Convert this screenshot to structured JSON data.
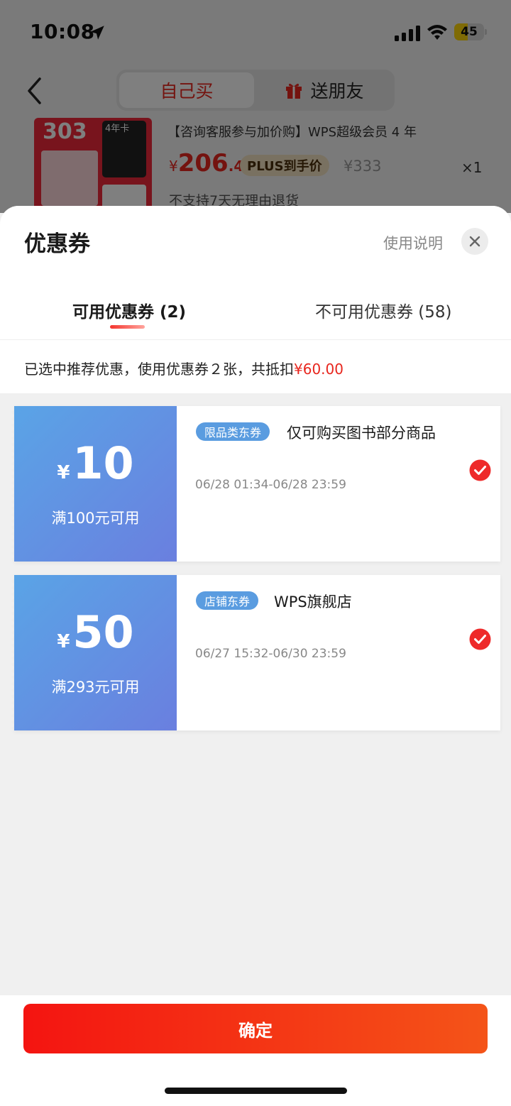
{
  "status_bar": {
    "time": "10:08",
    "battery": "45"
  },
  "background_page": {
    "tabs": {
      "self_buy": "自己买",
      "gift": "送朋友"
    },
    "product": {
      "title": "【咨询客服参与加价购】WPS超级会员 4 年",
      "price_currency": "¥",
      "price_int": "206",
      "price_dec": ".4",
      "plus_tag": "PLUS到手价",
      "original_price": "¥333",
      "quantity": "×1",
      "return_policy": "不支持7天无理由退货",
      "thumb_text": "303",
      "thumb_card_text": "4年卡"
    }
  },
  "sheet": {
    "title": "优惠券",
    "help_link": "使用说明",
    "tabs": {
      "available": "可用优惠券 (2)",
      "unavailable": "不可用优惠券 (58)"
    },
    "summary_text": "已选中推荐优惠，使用优惠券２张，共抵扣",
    "summary_amount": "¥60.00",
    "coupons": [
      {
        "currency": "¥",
        "value": "10",
        "condition": "满100元可用",
        "tag": "限品类东券",
        "description": "仅可购买图书部分商品",
        "validity": "06/28 01:34-06/28 23:59",
        "selected": true
      },
      {
        "currency": "¥",
        "value": "50",
        "condition": "满293元可用",
        "tag": "店铺东券",
        "description": "WPS旗舰店",
        "validity": "06/27 15:32-06/30 23:59",
        "selected": true
      }
    ],
    "confirm_button": "确定"
  },
  "colors": {
    "accent_red": "#e8261e",
    "coupon_blue_start": "#5aa4e6",
    "coupon_blue_end": "#6a7fdf",
    "tag_blue": "#5a9ce0"
  },
  "icons": [
    "location-arrow-icon",
    "signal-icon",
    "wifi-icon",
    "battery-icon",
    "back-chevron-icon",
    "gift-icon",
    "close-icon",
    "check-circle-icon"
  ]
}
